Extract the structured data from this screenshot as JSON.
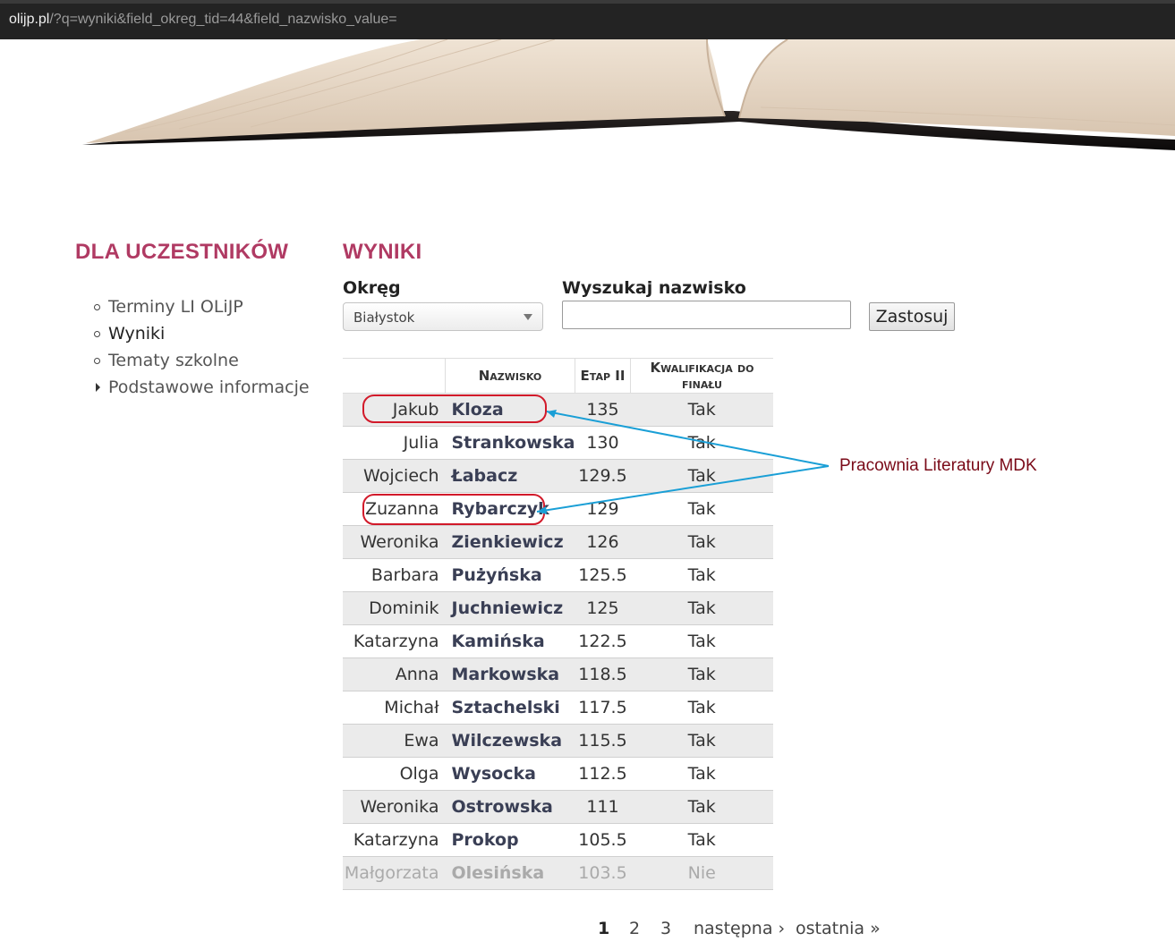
{
  "browser": {
    "url_host": "olijp.pl",
    "url_rest": "/?q=wyniki&field_okreg_tid=44&field_nazwisko_value="
  },
  "sidebar": {
    "title": "DLA UCZESTNIKÓW",
    "items": [
      {
        "label": "Terminy LI OLiJP"
      },
      {
        "label": "Wyniki"
      },
      {
        "label": "Tematy szkolne"
      },
      {
        "label": "Podstawowe informacje"
      }
    ]
  },
  "main": {
    "title": "WYNIKI"
  },
  "filters": {
    "district_label": "Okręg",
    "district_value": "Białystok",
    "search_label": "Wyszukaj nazwisko",
    "search_value": "",
    "apply_label": "Zastosuj"
  },
  "table": {
    "headers": {
      "first": "",
      "last": "Nazwisko",
      "stage": "Etap II",
      "qual": "Kwalifikacja do finału"
    },
    "rows": [
      {
        "first": "Jakub",
        "last": "Kloza",
        "score": "135",
        "qual": "Tak"
      },
      {
        "first": "Julia",
        "last": "Strankowska",
        "score": "130",
        "qual": "Tak"
      },
      {
        "first": "Wojciech",
        "last": "Łabacz",
        "score": "129.5",
        "qual": "Tak"
      },
      {
        "first": "Zuzanna",
        "last": "Rybarczyk",
        "score": "129",
        "qual": "Tak"
      },
      {
        "first": "Weronika",
        "last": "Zienkiewicz",
        "score": "126",
        "qual": "Tak"
      },
      {
        "first": "Barbara",
        "last": "Pużyńska",
        "score": "125.5",
        "qual": "Tak"
      },
      {
        "first": "Dominik",
        "last": "Juchniewicz",
        "score": "125",
        "qual": "Tak"
      },
      {
        "first": "Katarzyna",
        "last": "Kamińska",
        "score": "122.5",
        "qual": "Tak"
      },
      {
        "first": "Anna",
        "last": "Markowska",
        "score": "118.5",
        "qual": "Tak"
      },
      {
        "first": "Michał",
        "last": "Sztachelski",
        "score": "117.5",
        "qual": "Tak"
      },
      {
        "first": "Ewa",
        "last": "Wilczewska",
        "score": "115.5",
        "qual": "Tak"
      },
      {
        "first": "Olga",
        "last": "Wysocka",
        "score": "112.5",
        "qual": "Tak"
      },
      {
        "first": "Weronika",
        "last": "Ostrowska",
        "score": "111",
        "qual": "Tak"
      },
      {
        "first": "Katarzyna",
        "last": "Prokop",
        "score": "105.5",
        "qual": "Tak"
      },
      {
        "first": "Małgorzata",
        "last": "Olesińska",
        "score": "103.5",
        "qual": "Nie"
      }
    ]
  },
  "annotation": {
    "label": "Pracownia Literatury MDK",
    "color": "#7a0a18",
    "arrow_color": "#1a9fd6",
    "circle_color": "#d21a2a"
  },
  "pager": {
    "pages": [
      "1",
      "2",
      "3"
    ],
    "current": "1",
    "next": "następna ›",
    "last": "ostatnia »"
  }
}
